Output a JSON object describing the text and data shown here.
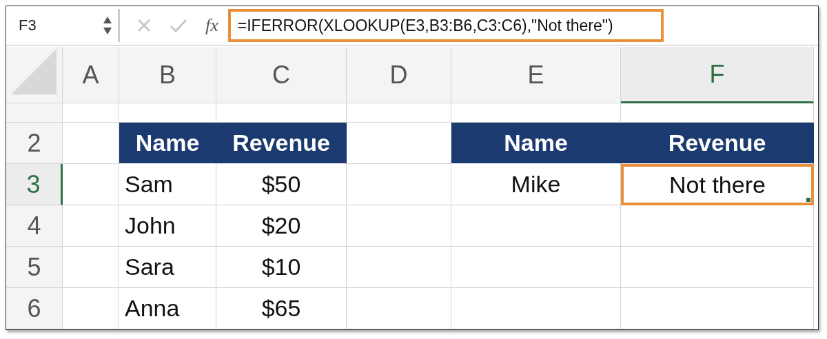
{
  "name_box": {
    "value": "F3"
  },
  "formula_bar": {
    "fx": "fx",
    "formula": "=IFERROR(XLOOKUP(E3,B3:B6,C3:C6),\"Not there\")",
    "highlighted": true
  },
  "columns": [
    {
      "label": "A",
      "selected": false
    },
    {
      "label": "B",
      "selected": false
    },
    {
      "label": "C",
      "selected": false
    },
    {
      "label": "D",
      "selected": false
    },
    {
      "label": "E",
      "selected": false
    },
    {
      "label": "F",
      "selected": true
    }
  ],
  "rows": [
    {
      "selected": false,
      "cells": [
        {
          "kind": "blank",
          "selected": false
        },
        {
          "kind": "blank",
          "selected": false
        },
        {
          "kind": "blank",
          "selected": false
        },
        {
          "kind": "blank",
          "selected": false
        },
        {
          "kind": "blank",
          "selected": false
        },
        {
          "kind": "blank",
          "selected": false
        }
      ]
    },
    {
      "label": "2",
      "selected": false,
      "cells": [
        {
          "kind": "blank",
          "selected": false
        },
        {
          "kind": "header",
          "text": "Name",
          "selected": false
        },
        {
          "kind": "header",
          "text": "Revenue",
          "selected": false
        },
        {
          "kind": "blank",
          "selected": false
        },
        {
          "kind": "header",
          "text": "Name",
          "selected": false
        },
        {
          "kind": "header",
          "text": "Revenue",
          "selected": false
        }
      ]
    },
    {
      "label": "3",
      "selected": true,
      "cells": [
        {
          "kind": "blank",
          "selected": false
        },
        {
          "kind": "label",
          "text": "Sam",
          "selected": false
        },
        {
          "kind": "value",
          "text": "$50",
          "selected": false
        },
        {
          "kind": "blank",
          "selected": false
        },
        {
          "kind": "value",
          "text": "Mike",
          "selected": false
        },
        {
          "kind": "value",
          "text": "Not there",
          "selected": true
        }
      ]
    },
    {
      "label": "4",
      "selected": false,
      "cells": [
        {
          "kind": "blank",
          "selected": false
        },
        {
          "kind": "label",
          "text": "John",
          "selected": false
        },
        {
          "kind": "value",
          "text": "$20",
          "selected": false
        },
        {
          "kind": "blank",
          "selected": false
        },
        {
          "kind": "blank",
          "selected": false
        },
        {
          "kind": "blank",
          "selected": false
        }
      ]
    },
    {
      "label": "5",
      "selected": false,
      "cells": [
        {
          "kind": "blank",
          "selected": false
        },
        {
          "kind": "label",
          "text": "Sara",
          "selected": false
        },
        {
          "kind": "value",
          "text": "$10",
          "selected": false
        },
        {
          "kind": "blank",
          "selected": false
        },
        {
          "kind": "blank",
          "selected": false
        },
        {
          "kind": "blank",
          "selected": false
        }
      ]
    },
    {
      "label": "6",
      "selected": false,
      "cells": [
        {
          "kind": "blank",
          "selected": false
        },
        {
          "kind": "label",
          "text": "Anna",
          "selected": false
        },
        {
          "kind": "value",
          "text": "$65",
          "selected": false
        },
        {
          "kind": "blank",
          "selected": false
        },
        {
          "kind": "blank",
          "selected": false
        },
        {
          "kind": "blank",
          "selected": false
        }
      ]
    }
  ]
}
